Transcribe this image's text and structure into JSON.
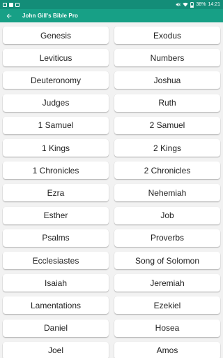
{
  "status_bar": {
    "battery_percent": "38%",
    "time": "14:21"
  },
  "app_bar": {
    "title": "John Gill's Bible Pro",
    "back_icon": "arrow-left-icon"
  },
  "colors": {
    "app_bar": "#17a086",
    "status_bar": "#138d78",
    "background": "#f2f2f2",
    "cell": "#ffffff",
    "text": "#222222"
  },
  "books": [
    [
      "Genesis",
      "Exodus"
    ],
    [
      "Leviticus",
      "Numbers"
    ],
    [
      "Deuteronomy",
      "Joshua"
    ],
    [
      "Judges",
      "Ruth"
    ],
    [
      "1 Samuel",
      "2 Samuel"
    ],
    [
      "1 Kings",
      "2 Kings"
    ],
    [
      "1 Chronicles",
      "2 Chronicles"
    ],
    [
      "Ezra",
      "Nehemiah"
    ],
    [
      "Esther",
      "Job"
    ],
    [
      "Psalms",
      "Proverbs"
    ],
    [
      "Ecclesiastes",
      "Song of Solomon"
    ],
    [
      "Isaiah",
      "Jeremiah"
    ],
    [
      "Lamentations",
      "Ezekiel"
    ],
    [
      "Daniel",
      "Hosea"
    ],
    [
      "Joel",
      "Amos"
    ]
  ]
}
